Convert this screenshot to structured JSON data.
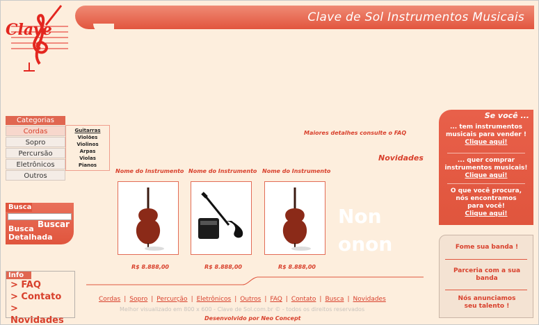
{
  "header": {
    "title": "Clave de Sol Instrumentos Musicais",
    "logo_text": "Clave"
  },
  "categories": {
    "header": "Categorias",
    "items": [
      "Cordas",
      "Sopro",
      "Percursão",
      "Eletrônicos",
      "Outros"
    ],
    "subitems": [
      "Guitarras",
      "Violões",
      "Violinos",
      "Arpas",
      "Violas",
      "Pianos"
    ]
  },
  "search": {
    "label": "Busca",
    "button": "Buscar",
    "advanced": "Busca Detalhada"
  },
  "info": {
    "label": "Info",
    "links": [
      "> FAQ",
      "> Contato",
      "> Novidades"
    ]
  },
  "main": {
    "faq_note": "Maiores detalhes consulte o FAQ",
    "section_title": "Novidades",
    "products": [
      {
        "name": "Nome do Instrumento",
        "price": "R$ 8.888,00",
        "kind": "cello"
      },
      {
        "name": "Nome do Instrumento",
        "price": "R$ 8.888,00",
        "kind": "bass"
      },
      {
        "name": "Nome do Instrumento",
        "price": "R$ 8.888,00",
        "kind": "cello"
      }
    ],
    "watermark_lines": [
      "Non",
      "onon"
    ]
  },
  "promo": {
    "title": "Se você ...",
    "blocks": [
      {
        "text": "... tem instrumentos musicais para vender !",
        "link": "Clique aqui!"
      },
      {
        "text": "... quer comprar instrumentos musicais!",
        "link": "Clique aqui!"
      },
      {
        "text": "O que você procura, nós encontramos para você!",
        "link": "Clique aqui!"
      }
    ]
  },
  "side2": {
    "items": [
      "Fome sua banda !",
      "Parceria com a sua banda",
      "Nós anunciamos seu talento !"
    ]
  },
  "footer": {
    "links": [
      "Cordas",
      "Sopro",
      "Percurção",
      "Eletrônicos",
      "Outros",
      "FAQ",
      "Contato",
      "Busca",
      "Novidades"
    ],
    "note": "Melhor visualizado em 800 x 600  -  Clave de Sol.com.br ©   -   todos os direitos reservados",
    "dev": "Desenvolvido por Neo Concept"
  },
  "colors": {
    "accent": "#e0553d",
    "background": "#fdeedd",
    "link": "#d8402c"
  }
}
